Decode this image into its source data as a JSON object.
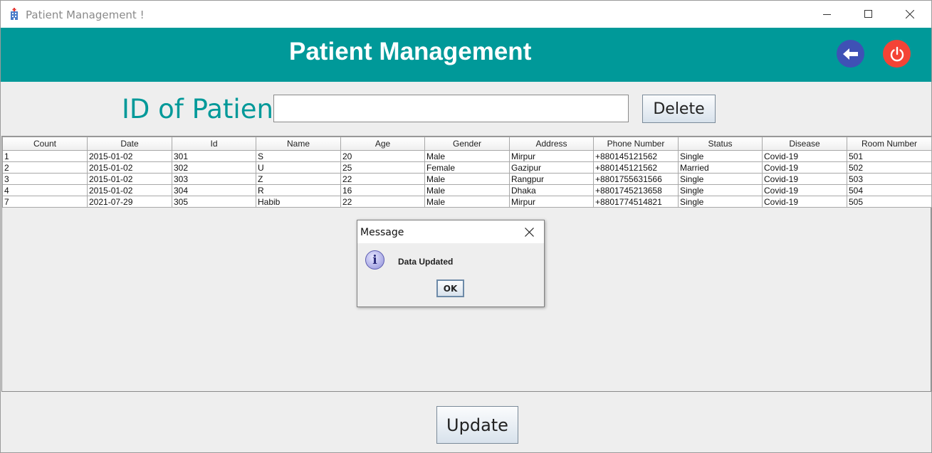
{
  "window": {
    "title": "Patient Management !"
  },
  "header": {
    "title": "Patient Management",
    "back_icon": "arrow-left-icon",
    "power_icon": "power-icon",
    "back_color": "#3f51b5",
    "power_color": "#f44336",
    "bg_color": "#009999"
  },
  "search": {
    "label": "ID of Patient",
    "value": "",
    "delete_label": "Delete"
  },
  "table": {
    "columns": [
      "Count",
      "Date",
      "Id",
      "Name",
      "Age",
      "Gender",
      "Address",
      "Phone Number",
      "Status",
      "Disease",
      "Room Number"
    ],
    "rows": [
      [
        "1",
        "2015-01-02",
        "301",
        "S",
        "20",
        "Male",
        "Mirpur",
        "+880145121562",
        "Single",
        "Covid-19",
        "501"
      ],
      [
        "2",
        "2015-01-02",
        "302",
        "U",
        "25",
        "Female",
        "Gazipur",
        "+880145121562",
        "Married",
        "Covid-19",
        "502"
      ],
      [
        "3",
        "2015-01-02",
        "303",
        "Z",
        "22",
        "Male",
        "Rangpur",
        "+8801755631566",
        "Single",
        "Covid-19",
        "503"
      ],
      [
        "4",
        "2015-01-02",
        "304",
        "R",
        "16",
        "Male",
        "Dhaka",
        "+8801745213658",
        "Single",
        "Covid-19",
        "504"
      ],
      [
        "7",
        "2021-07-29",
        "305",
        "Habib",
        "22",
        "Male",
        "Mirpur",
        "+8801774514821",
        "Single",
        "Covid-19",
        "505"
      ]
    ]
  },
  "footer": {
    "update_label": "Update"
  },
  "dialog": {
    "title": "Message",
    "message": "Data Updated",
    "ok_label": "OK",
    "icon": "info-icon"
  }
}
